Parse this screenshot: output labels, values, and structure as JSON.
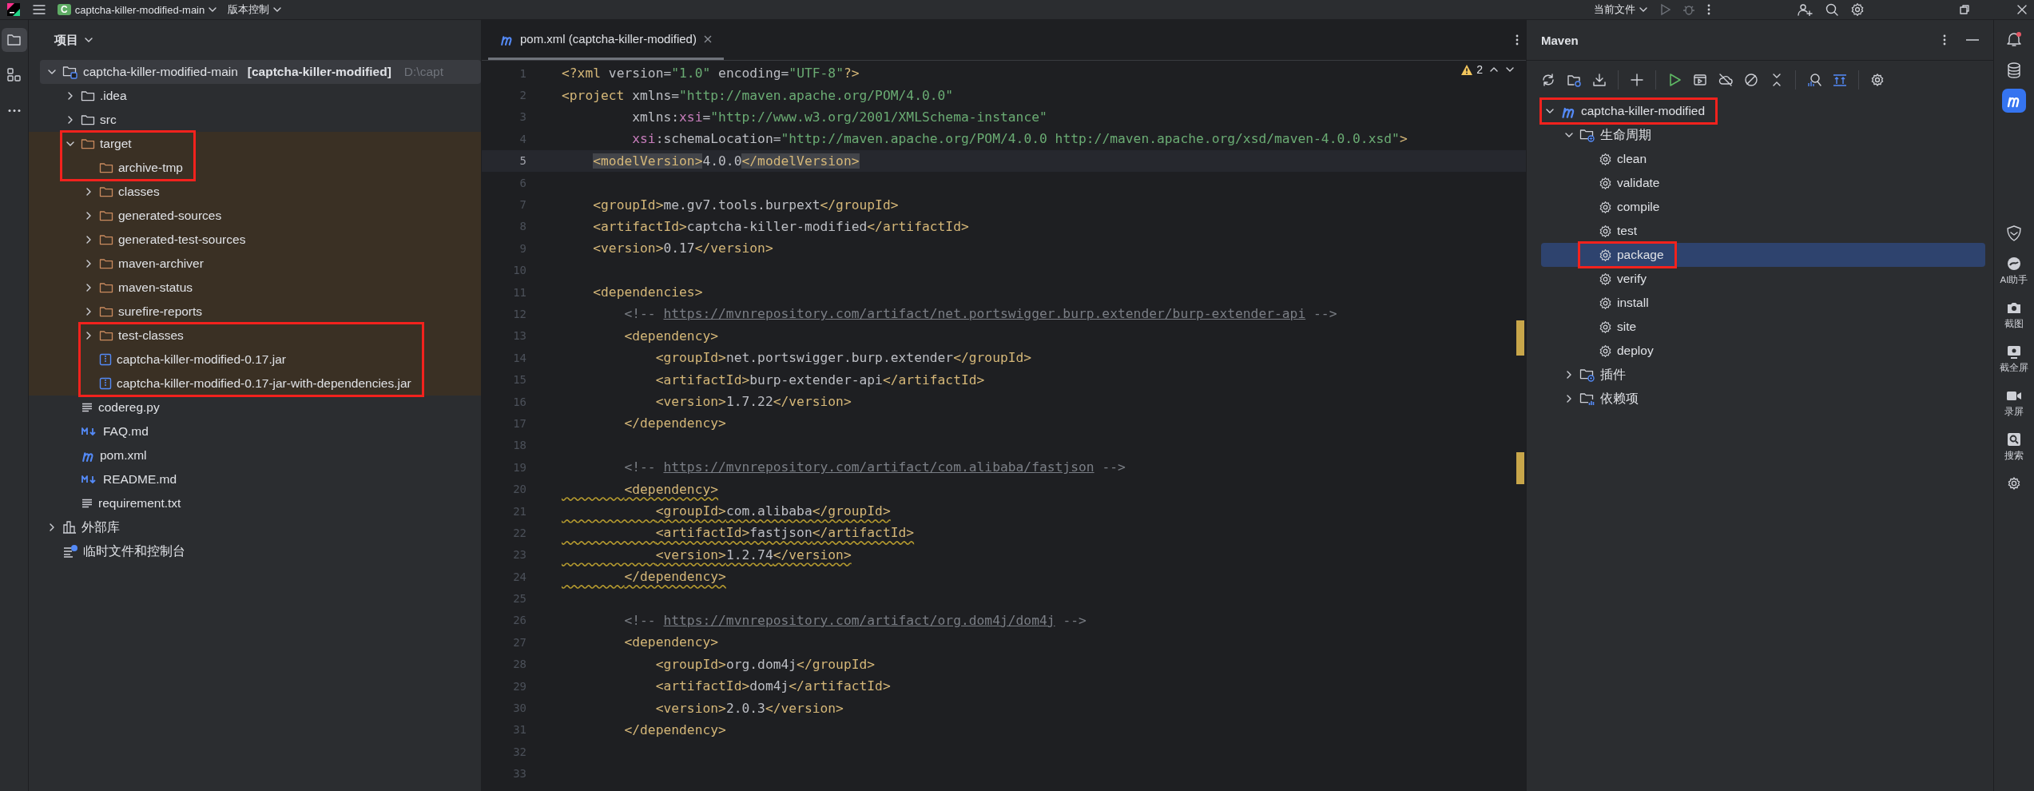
{
  "top_bar": {
    "project_badge": "C",
    "project": "captcha-killer-modified-main",
    "vcs": "版本控制",
    "run_target": "当前文件"
  },
  "tool_strip": [
    {
      "kind": "project",
      "selected": true
    },
    {
      "kind": "structure",
      "selected": false
    },
    {
      "kind": "more",
      "selected": false
    }
  ],
  "project_panel": {
    "title": "项目",
    "tree": [
      {
        "kind": "module",
        "name": "captcha-killer-modified-main",
        "module": "[captcha-killer-modified]",
        "path": "D:\\capt",
        "expanded": true,
        "selected": true,
        "annotated": false,
        "children": [
          {
            "kind": "folder",
            "name": ".idea",
            "expanded": false,
            "selected": false,
            "annotated": false
          },
          {
            "kind": "folder",
            "name": "src",
            "expanded": false,
            "selected": false,
            "annotated": false
          },
          {
            "kind": "folder",
            "name": "target",
            "excluded": true,
            "expanded": true,
            "selected": false,
            "annotated": true,
            "children": [
              {
                "kind": "folder",
                "name": "archive-tmp",
                "selected": false,
                "annotated": true
              },
              {
                "kind": "folder",
                "name": "classes",
                "expanded": false,
                "selected": false,
                "annotated": false
              },
              {
                "kind": "folder",
                "name": "generated-sources",
                "expanded": false,
                "selected": false,
                "annotated": false
              },
              {
                "kind": "folder",
                "name": "generated-test-sources",
                "expanded": false,
                "selected": false,
                "annotated": false
              },
              {
                "kind": "folder",
                "name": "maven-archiver",
                "expanded": false,
                "selected": false,
                "annotated": false
              },
              {
                "kind": "folder",
                "name": "maven-status",
                "expanded": false,
                "selected": false,
                "annotated": false
              },
              {
                "kind": "folder",
                "name": "surefire-reports",
                "expanded": false,
                "selected": false,
                "annotated": false
              },
              {
                "kind": "folder",
                "name": "test-classes",
                "expanded": false,
                "selected": false,
                "annotated": true
              },
              {
                "kind": "jar",
                "name": "captcha-killer-modified-0.17.jar",
                "selected": false,
                "annotated": true
              },
              {
                "kind": "jar",
                "name": "captcha-killer-modified-0.17-jar-with-dependencies.jar",
                "selected": false,
                "annotated": true
              }
            ]
          },
          {
            "kind": "text",
            "name": "codereg.py",
            "selected": false,
            "annotated": false
          },
          {
            "kind": "markdown",
            "name": "FAQ.md",
            "selected": false,
            "annotated": false
          },
          {
            "kind": "maven",
            "name": "pom.xml",
            "selected": false,
            "annotated": false
          },
          {
            "kind": "markdown",
            "name": "README.md",
            "selected": false,
            "annotated": false
          },
          {
            "kind": "text",
            "name": "requirement.txt",
            "selected": false,
            "annotated": false
          }
        ]
      },
      {
        "kind": "library",
        "name": "外部库",
        "expanded": false,
        "selected": false,
        "annotated": false
      },
      {
        "kind": "scratches",
        "name": "临时文件和控制台",
        "selected": false,
        "annotated": false
      }
    ]
  },
  "editor": {
    "tab": {
      "title": "pom.xml (captcha-killer-modified)",
      "selected": true
    },
    "warnings": "2",
    "lines": [
      {
        "n": "1",
        "current": false,
        "tokens": [
          {
            "kind": "tag",
            "text": "<?xml"
          },
          {
            "kind": "attr",
            "text": " version"
          },
          {
            "kind": "plain",
            "text": "="
          },
          {
            "kind": "string",
            "text": "\"1.0\""
          },
          {
            "kind": "attr",
            "text": " encoding"
          },
          {
            "kind": "plain",
            "text": "="
          },
          {
            "kind": "string",
            "text": "\"UTF-8\""
          },
          {
            "kind": "tag",
            "text": "?>"
          }
        ]
      },
      {
        "n": "2",
        "current": false,
        "tokens": [
          {
            "kind": "tag",
            "text": "<project"
          },
          {
            "kind": "attr",
            "text": " xmlns"
          },
          {
            "kind": "plain",
            "text": "="
          },
          {
            "kind": "string",
            "text": "\"http://maven.apache.org/POM/4.0.0\""
          }
        ]
      },
      {
        "n": "3",
        "current": false,
        "tokens": [
          {
            "kind": "attr",
            "text": "         xmlns:"
          },
          {
            "kind": "namespace",
            "text": "xsi"
          },
          {
            "kind": "plain",
            "text": "="
          },
          {
            "kind": "string",
            "text": "\"http://www.w3.org/2001/XMLSchema-instance\""
          }
        ]
      },
      {
        "n": "4",
        "current": false,
        "tokens": [
          {
            "kind": "namespace",
            "text": "         xsi"
          },
          {
            "kind": "attr",
            "text": ":schemaLocation"
          },
          {
            "kind": "plain",
            "text": "="
          },
          {
            "kind": "string",
            "text": "\"http://maven.apache.org/POM/4.0.0 http://maven.apache.org/xsd/maven-4.0.0.xsd\""
          },
          {
            "kind": "tag",
            "text": ">"
          }
        ]
      },
      {
        "n": "5",
        "current": true,
        "tokens": [
          {
            "kind": "tag",
            "text": "    <modelVersion>",
            "match": true
          },
          {
            "kind": "plain",
            "text": "4.0.0"
          },
          {
            "kind": "tag",
            "text": "</modelVersion>",
            "match": true
          }
        ]
      },
      {
        "n": "6",
        "current": false
      },
      {
        "n": "7",
        "current": false,
        "tokens": [
          {
            "kind": "tag",
            "text": "    <groupId>"
          },
          {
            "kind": "plain",
            "text": "me.gv7.tools.burpext"
          },
          {
            "kind": "tag",
            "text": "</groupId>"
          }
        ]
      },
      {
        "n": "8",
        "current": false,
        "tokens": [
          {
            "kind": "tag",
            "text": "    <artifactId>"
          },
          {
            "kind": "plain",
            "text": "captcha-killer-modified"
          },
          {
            "kind": "tag",
            "text": "</artifactId>"
          }
        ]
      },
      {
        "n": "9",
        "current": false,
        "tokens": [
          {
            "kind": "tag",
            "text": "    <version>"
          },
          {
            "kind": "plain",
            "text": "0.17"
          },
          {
            "kind": "tag",
            "text": "</version>"
          }
        ]
      },
      {
        "n": "10",
        "current": false
      },
      {
        "n": "11",
        "current": false,
        "tokens": [
          {
            "kind": "tag",
            "text": "    <dependencies>"
          }
        ]
      },
      {
        "n": "12",
        "current": false,
        "tokens": [
          {
            "kind": "comment",
            "text": "        <!--"
          },
          {
            "kind": "link",
            "text": "https://mvnrepository.com/artifact/net.portswigger.burp.extender/burp-extender-api"
          },
          {
            "kind": "comment",
            "text": "-->"
          }
        ]
      },
      {
        "n": "13",
        "current": false,
        "tokens": [
          {
            "kind": "tag",
            "text": "        <dependency>"
          }
        ]
      },
      {
        "n": "14",
        "current": false,
        "tokens": [
          {
            "kind": "tag",
            "text": "            <groupId>"
          },
          {
            "kind": "plain",
            "text": "net.portswigger.burp.extender"
          },
          {
            "kind": "tag",
            "text": "</groupId>"
          }
        ]
      },
      {
        "n": "15",
        "current": false,
        "tokens": [
          {
            "kind": "tag",
            "text": "            <artifactId>"
          },
          {
            "kind": "plain",
            "text": "burp-extender-api"
          },
          {
            "kind": "tag",
            "text": "</artifactId>"
          }
        ]
      },
      {
        "n": "16",
        "current": false,
        "tokens": [
          {
            "kind": "tag",
            "text": "            <version>"
          },
          {
            "kind": "plain",
            "text": "1.7.22"
          },
          {
            "kind": "tag",
            "text": "</version>"
          }
        ]
      },
      {
        "n": "17",
        "current": false,
        "tokens": [
          {
            "kind": "tag",
            "text": "        </dependency>"
          }
        ]
      },
      {
        "n": "18",
        "current": false
      },
      {
        "n": "19",
        "current": false,
        "tokens": [
          {
            "kind": "comment",
            "text": "        <!--"
          },
          {
            "kind": "link",
            "text": "https://mvnrepository.com/artifact/com.alibaba/fastjson"
          },
          {
            "kind": "comment",
            "text": "-->"
          }
        ]
      },
      {
        "n": "20",
        "current": false,
        "tokens": [
          {
            "kind": "tag",
            "text": "        <dependency>",
            "warn": true
          }
        ]
      },
      {
        "n": "21",
        "current": false,
        "tokens": [
          {
            "kind": "tag",
            "text": "            <groupId>",
            "warn": true
          },
          {
            "kind": "plain",
            "text": "com.alibaba",
            "warn": true
          },
          {
            "kind": "tag",
            "text": "</groupId>",
            "warn": true
          }
        ]
      },
      {
        "n": "22",
        "current": false,
        "tokens": [
          {
            "kind": "tag",
            "text": "            <artifactId>",
            "warn": true
          },
          {
            "kind": "plain",
            "text": "fastjson",
            "warn": true
          },
          {
            "kind": "tag",
            "text": "</artifactId>",
            "warn": true
          }
        ]
      },
      {
        "n": "23",
        "current": false,
        "tokens": [
          {
            "kind": "tag",
            "text": "            <version>",
            "warn": true
          },
          {
            "kind": "plain",
            "text": "1.2.74",
            "warn": true
          },
          {
            "kind": "tag",
            "text": "</version>",
            "warn": true
          }
        ]
      },
      {
        "n": "24",
        "current": false,
        "tokens": [
          {
            "kind": "tag",
            "text": "        </dependency>",
            "warn": true
          }
        ]
      },
      {
        "n": "25",
        "current": false
      },
      {
        "n": "26",
        "current": false,
        "tokens": [
          {
            "kind": "comment",
            "text": "        <!--"
          },
          {
            "kind": "link",
            "text": "https://mvnrepository.com/artifact/org.dom4j/dom4j"
          },
          {
            "kind": "comment",
            "text": "-->"
          }
        ]
      },
      {
        "n": "27",
        "current": false,
        "tokens": [
          {
            "kind": "tag",
            "text": "        <dependency>"
          }
        ]
      },
      {
        "n": "28",
        "current": false,
        "tokens": [
          {
            "kind": "tag",
            "text": "            <groupId>"
          },
          {
            "kind": "plain",
            "text": "org.dom4j"
          },
          {
            "kind": "tag",
            "text": "</groupId>"
          }
        ]
      },
      {
        "n": "29",
        "current": false,
        "tokens": [
          {
            "kind": "tag",
            "text": "            <artifactId>"
          },
          {
            "kind": "plain",
            "text": "dom4j"
          },
          {
            "kind": "tag",
            "text": "</artifactId>"
          }
        ]
      },
      {
        "n": "30",
        "current": false,
        "tokens": [
          {
            "kind": "tag",
            "text": "            <version>"
          },
          {
            "kind": "plain",
            "text": "2.0.3"
          },
          {
            "kind": "tag",
            "text": "</version>"
          }
        ]
      },
      {
        "n": "31",
        "current": false,
        "tokens": [
          {
            "kind": "tag",
            "text": "        </dependency>"
          }
        ]
      },
      {
        "n": "32",
        "current": false
      },
      {
        "n": "33",
        "current": false
      }
    ]
  },
  "maven_panel": {
    "title": "Maven",
    "tree": [
      {
        "kind": "project",
        "name": "captcha-killer-modified",
        "expanded": true,
        "selected": false,
        "annotated": true,
        "children": [
          {
            "kind": "lifecycle",
            "name": "生命周期",
            "expanded": true,
            "selected": false,
            "annotated": false,
            "children": [
              {
                "kind": "goal",
                "name": "clean",
                "selected": false,
                "annotated": false
              },
              {
                "kind": "goal",
                "name": "validate",
                "selected": false,
                "annotated": false
              },
              {
                "kind": "goal",
                "name": "compile",
                "selected": false,
                "annotated": false
              },
              {
                "kind": "goal",
                "name": "test",
                "selected": false,
                "annotated": false
              },
              {
                "kind": "goal",
                "name": "package",
                "selected": true,
                "annotated": true
              },
              {
                "kind": "goal",
                "name": "verify",
                "selected": false,
                "annotated": false
              },
              {
                "kind": "goal",
                "name": "install",
                "selected": false,
                "annotated": false
              },
              {
                "kind": "goal",
                "name": "site",
                "selected": false,
                "annotated": false
              },
              {
                "kind": "goal",
                "name": "deploy",
                "selected": false,
                "annotated": false
              }
            ]
          },
          {
            "kind": "plugins",
            "name": "插件",
            "expanded": false,
            "selected": false,
            "annotated": false
          },
          {
            "kind": "dependencies",
            "name": "依赖项",
            "expanded": false,
            "selected": false,
            "annotated": false
          }
        ]
      }
    ]
  },
  "right_strip": [
    {
      "kind": "notifications",
      "unread": true,
      "selected": false
    },
    {
      "kind": "database",
      "selected": false
    },
    {
      "kind": "maven",
      "selected": true
    },
    {
      "kind": "shield",
      "selected": false
    },
    {
      "kind": "ai",
      "label": "AI助手",
      "selected": false
    },
    {
      "kind": "camera",
      "label": "截图",
      "selected": false
    },
    {
      "kind": "screen",
      "label": "截全屏",
      "selected": false
    },
    {
      "kind": "record",
      "label": "录屏",
      "selected": false
    },
    {
      "kind": "search",
      "label": "搜索",
      "selected": false
    },
    {
      "kind": "settings",
      "selected": false
    }
  ]
}
